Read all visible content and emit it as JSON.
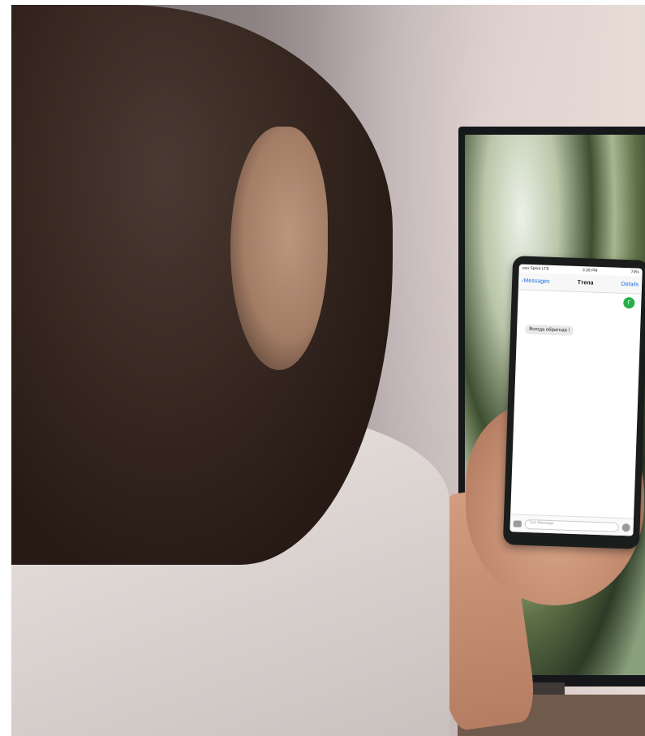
{
  "photo": {
    "description_colors": {
      "hair": "#2b1d18",
      "wall": "#c6b8b6",
      "shirt": "#e3ddd9",
      "tv_frame": "#16171b",
      "skin": "#c99277"
    }
  },
  "phone": {
    "status": {
      "carrier": "ooo Sprint LTE",
      "time": "3:39 PM",
      "battery": "74%"
    },
    "nav": {
      "back_label": "Messages",
      "title": "Ттепа",
      "details_label": "Details"
    },
    "avatar_initial": "Г",
    "message": "Всегда обратная !",
    "input_placeholder": "Text Message"
  }
}
